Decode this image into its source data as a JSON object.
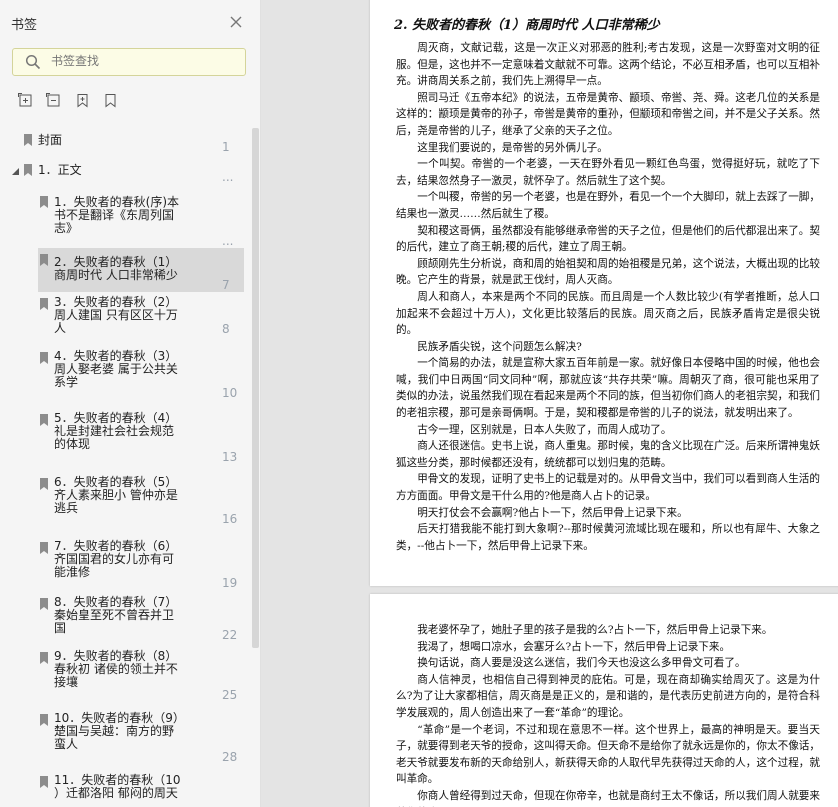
{
  "sidebar": {
    "title": "书签",
    "search_placeholder": "书签查找",
    "items": [
      {
        "label": "封面",
        "page": "1"
      },
      {
        "label": "1．正文",
        "page": "..."
      },
      {
        "label": "1．失败者的春秋(序)本\n书不是翻译《东周列国\n志》",
        "page": "..."
      },
      {
        "label": "2．失败者的春秋（1）\n商周时代 人口非常稀少",
        "page": "7"
      },
      {
        "label": "3．失败者的春秋（2）\n周人建国 只有区区十万\n人",
        "page": "8"
      },
      {
        "label": "4．失败者的春秋（3）\n周人娶老婆 属于公共关\n系学",
        "page": "10"
      },
      {
        "label": "5．失败者的春秋（4）\n礼是封建社会社会规范\n的体现",
        "page": "13"
      },
      {
        "label": "6．失败者的春秋（5）\n齐人素来胆小 管仲亦是\n逃兵",
        "page": "16"
      },
      {
        "label": "7．失败者的春秋（6）\n齐国国君的女儿亦有可\n能淮修",
        "page": "19"
      },
      {
        "label": "8．失败者的春秋（7）\n秦始皇至死不曾吞并卫\n国",
        "page": "22"
      },
      {
        "label": "9．失败者的春秋（8）\n春秋初 诸侯的领土并不\n接壤",
        "page": "25"
      },
      {
        "label": "10．失败者的春秋（9）\n楚国与吴越：南方的野\n蛮人",
        "page": "28"
      },
      {
        "label": "11．失败者的春秋（10\n）迁都洛阳 郁闷的周天",
        "page": ""
      }
    ]
  },
  "document": {
    "page1_title": "2. 失败者的春秋（1）商周时代 人口非常稀少",
    "page1_paragraphs": [
      "周灭商，文献记载，这是一次正义对邪恶的胜利;考古发现，这是一次野蛮对文明的征服。但是，这也并不一定意味着文献就不可靠。这两个结论，不必互相矛盾，也可以互相补充。讲商周关系之前，我们先上溯得早一点。",
      "照司马迁《五帝本纪》的说法，五帝是黄帝、颛顼、帝喾、尧、舜。这老几位的关系是这样的：颛顼是黄帝的孙子，帝喾是黄帝的重孙，但颛顼和帝喾之间，并不是父子关系。然后，尧是帝喾的儿子，继承了父亲的天子之位。",
      "这里我们要说的，是帝喾的另外俩儿子。",
      "一个叫契。帝喾的一个老婆，一天在野外看见一颗红色鸟蛋，觉得挺好玩，就吃了下去，结果忽然身子一激灵，就怀孕了。然后就生了这个契。",
      "一个叫稷，帝喾的另一个老婆，也是在野外，看见一个一个大脚印，就上去踩了一脚，结果也一激灵……然后就生了稷。",
      "契和稷这哥俩，虽然都没有能够继承帝喾的天子之位，但是他们的后代都混出来了。契的后代，建立了商王朝;稷的后代，建立了周王朝。",
      "顾颉刚先生分析说，商和周的始祖契和周的始祖稷是兄弟，这个说法，大概出现的比较晚。它产生的背景，就是武王伐纣，周人灭商。",
      "周人和商人，本来是两个不同的民族。而且周是一个人数比较少(有学者推断，总人口加起来不会超过十万人)，文化更比较落后的民族。周灭商之后，民族矛盾肯定是很尖锐的。",
      "民族矛盾尖锐，这个问题怎么解决?",
      "一个简易的办法，就是宣称大家五百年前是一家。就好像日本侵略中国的时候，他也会喊，我们中日两国“同文同种”啊，那就应该“共存共荣”嘛。周朝灭了商，很可能也采用了类似的办法，说虽然我们现在看起来是两个不同的族，但当初你们商人的老祖宗契，和我们的老祖宗稷，那可是亲哥俩啊。于是，契和稷都是帝喾的儿子的说法，就发明出来了。",
      "古今一理，区别就是，日本人失败了，而周人成功了。",
      "商人还很迷信。史书上说，商人重鬼。那时候，鬼的含义比现在广泛。后来所谓神鬼妖狐这些分类，那时候都还没有，统统都可以划归鬼的范畴。",
      "甲骨文的发现，证明了史书上的记载是对的。从甲骨文当中，我们可以看到商人生活的方方面面。甲骨文是干什么用的?他是商人占卜的记录。",
      "明天打仗会不会赢啊?他占卜一下，然后甲骨上记录下来。",
      "后天打猎我能不能打到大象啊?--那时候黄河流域比现在暖和，所以也有犀牛、大象之类，--他占卜一下，然后甲骨上记录下来。"
    ],
    "page2_paragraphs": [
      "我老婆怀孕了，她肚子里的孩子是我的么?占卜一下，然后甲骨上记录下来。",
      "我渴了，想喝口凉水，会塞牙么?占卜一下，然后甲骨上记录下来。",
      "换句话说，商人要是没这么迷信，我们今天也没这么多甲骨文可看了。",
      "商人信神灵，也相信自己得到神灵的庇佑。可是，现在商却确实给周灭了。这是为什么?为了让大家都相信，周灭商是是正义的，是和谐的，是代表历史前进方向的，是符合科学发展观的，周人创造出来了一套“革命”的理论。",
      "“革命”是一个老词，不过和现在意思不一样。这个世界上，最高的神明是天。要当天子，就要得到老天爷的授命，这叫得天命。但天命不是给你了就永远是你的，你太不像话，老天爷就要发布新的天命给别人，新获得天命的人取代早先获得过天命的人，这个过程，就叫革命。",
      "你商人曾经得到过天命，但现在你帝辛，也就是商纣王太不像话，所以我们周人就要来革你的命了。"
    ]
  },
  "colors": {
    "sidebar_bg": "#f5f5f5",
    "search_bg": "#fcfce6",
    "selected_bg": "#d9d9d9",
    "page_number": "#9aa3ad",
    "viewer_bg": "#e4e4e4"
  }
}
